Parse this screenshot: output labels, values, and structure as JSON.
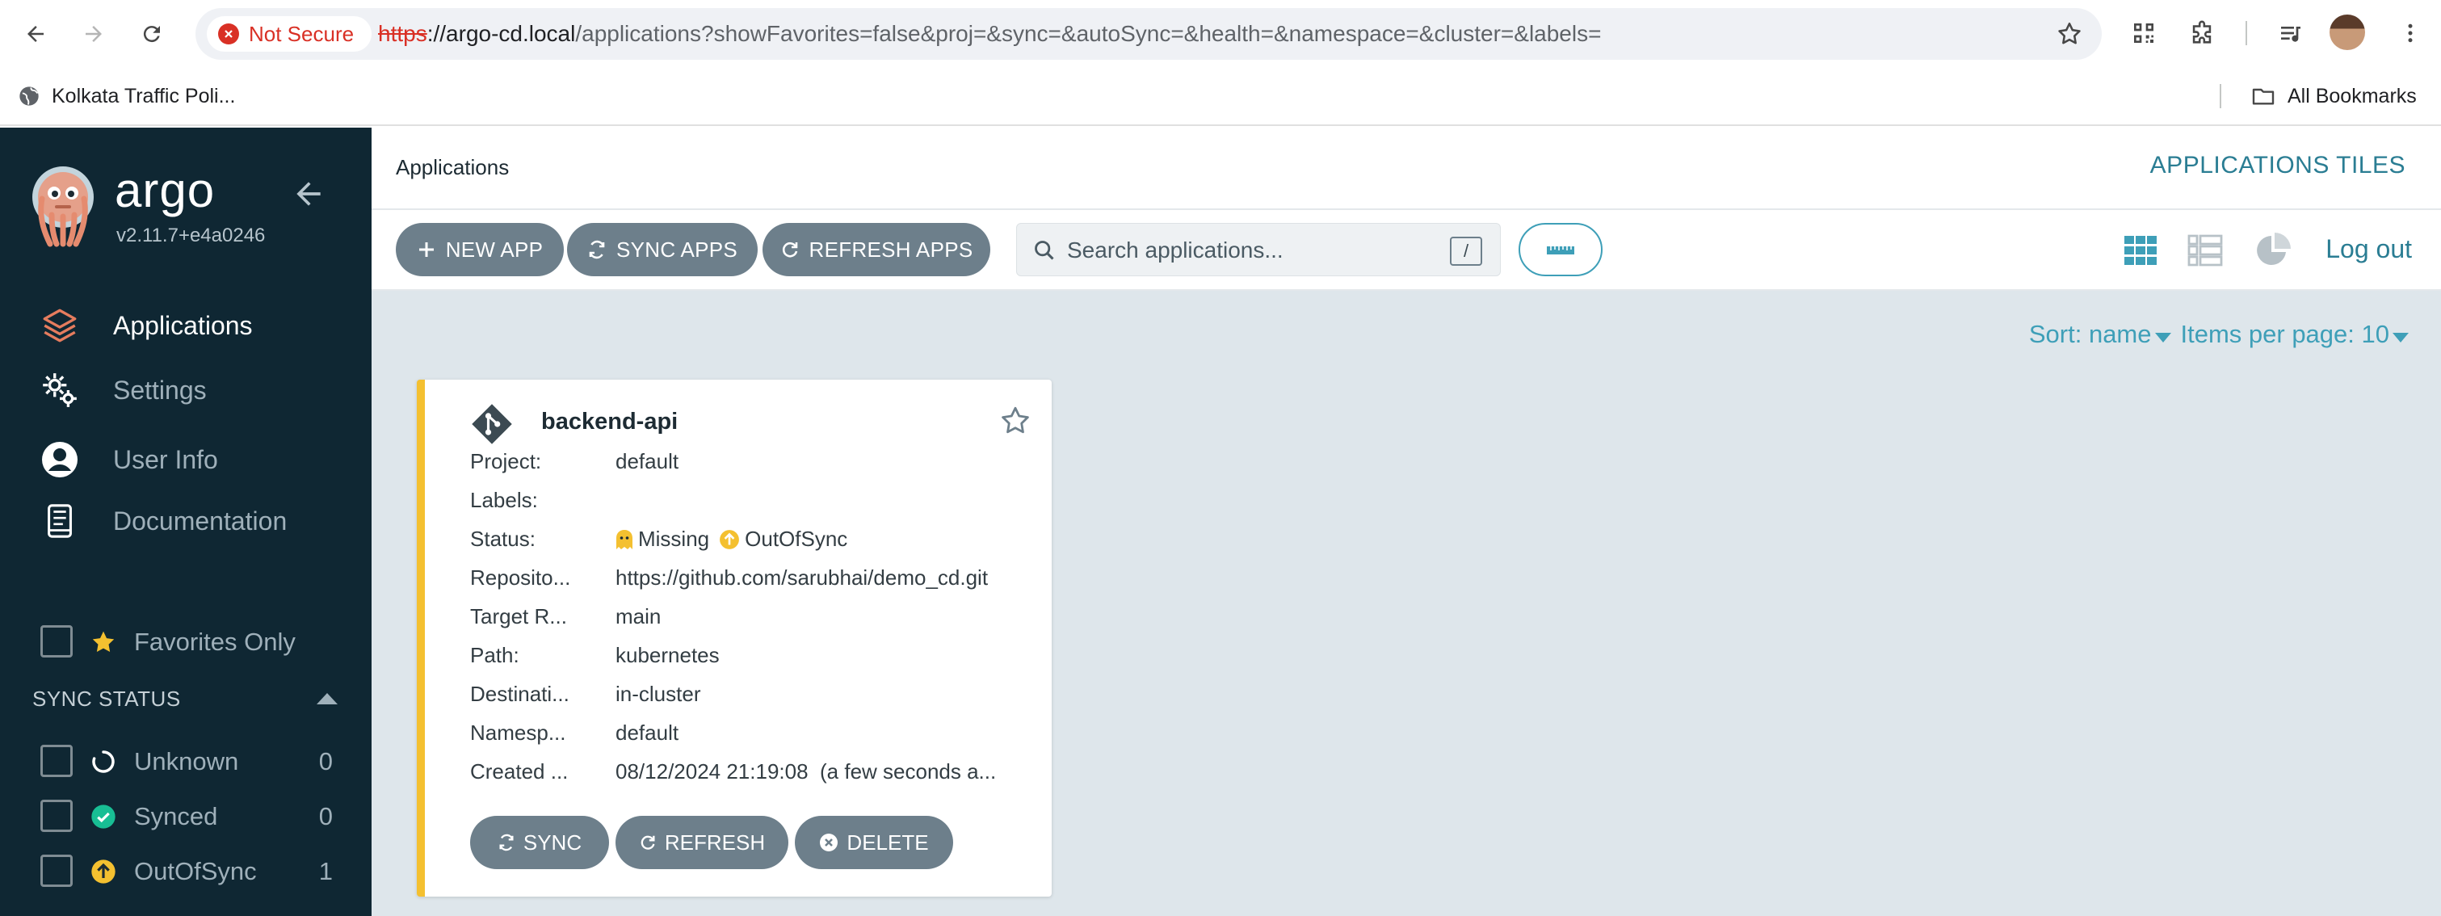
{
  "browser": {
    "security_label": "Not Secure",
    "url_scheme": "https",
    "url_host": "://argo-cd.local",
    "url_path": "/applications?showFavorites=false&proj=&sync=&autoSync=&health=&namespace=&cluster=&labels=",
    "bookmark": "Kolkata Traffic Poli...",
    "all_bookmarks": "All Bookmarks"
  },
  "sidebar": {
    "brand": "argo",
    "version": "v2.11.7+e4a0246",
    "nav": [
      {
        "label": "Applications",
        "icon": "layers-icon",
        "active": true
      },
      {
        "label": "Settings",
        "icon": "gears-icon",
        "active": false
      },
      {
        "label": "User Info",
        "icon": "user-circle-icon",
        "active": false
      },
      {
        "label": "Documentation",
        "icon": "book-icon",
        "active": false
      }
    ],
    "favorites_label": "Favorites Only",
    "sync_section_title": "SYNC STATUS",
    "sync_filters": [
      {
        "label": "Unknown",
        "count": "0"
      },
      {
        "label": "Synced",
        "count": "0"
      },
      {
        "label": "OutOfSync",
        "count": "1"
      }
    ]
  },
  "header": {
    "breadcrumb": "Applications",
    "view_title": "APPLICATIONS TILES"
  },
  "toolbar": {
    "new_app": "NEW APP",
    "sync_apps": "SYNC APPS",
    "refresh_apps": "REFRESH APPS",
    "search_placeholder": "Search applications...",
    "search_shortcut": "/",
    "logout": "Log out"
  },
  "sort": {
    "sort_label": "Sort: name",
    "per_page_label": "Items per page: 10"
  },
  "app_card": {
    "name": "backend-api",
    "fields": [
      {
        "key": "Project:",
        "value": "default"
      },
      {
        "key": "Labels:",
        "value": ""
      },
      {
        "key": "Status:",
        "value": ""
      },
      {
        "key": "Reposito...",
        "value": "https://github.com/sarubhai/demo_cd.git"
      },
      {
        "key": "Target R...",
        "value": "main"
      },
      {
        "key": "Path:",
        "value": "kubernetes"
      },
      {
        "key": "Destinati...",
        "value": "in-cluster"
      },
      {
        "key": "Namesp...",
        "value": "default"
      },
      {
        "key": "Created ...",
        "value": "08/12/2024 21:19:08  (a few seconds a..."
      }
    ],
    "health_status": "Missing",
    "sync_status": "OutOfSync",
    "sync_button": "SYNC",
    "refresh_button": "REFRESH",
    "delete_button": "DELETE"
  },
  "colors": {
    "sidebar_bg": "#0f2733",
    "accent": "#3e9fb8",
    "button_bg": "#6d7f8b",
    "content_bg": "#dee6eb",
    "missing": "#f4c030",
    "synced": "#18be94"
  }
}
